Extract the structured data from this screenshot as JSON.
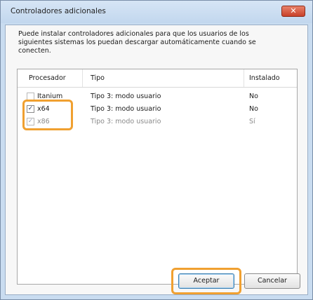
{
  "dialog": {
    "title": "Controladores adicionales",
    "close_label": "✕",
    "description": "Puede instalar controladores adicionales para que los usuarios de los siguientes sistemas los puedan descargar automáticamente cuando se conecten."
  },
  "table": {
    "headers": [
      "Procesador",
      "Tipo",
      "Instalado"
    ],
    "rows": [
      {
        "checked": false,
        "processor": "Itanium",
        "type": "Tipo 3: modo usuario",
        "installed": "No",
        "disabled": false
      },
      {
        "checked": true,
        "processor": "x64",
        "type": "Tipo 3: modo usuario",
        "installed": "No",
        "disabled": false
      },
      {
        "checked": true,
        "processor": "x86",
        "type": "Tipo 3: modo usuario",
        "installed": "Sí",
        "disabled": true
      }
    ]
  },
  "buttons": {
    "ok_label": "Aceptar",
    "cancel_label": "Cancelar"
  },
  "colors": {
    "highlight": "#f0a030",
    "titlebar": "#c9dcf0"
  },
  "icons": {
    "checkbox_checked": "checkmark-icon"
  }
}
